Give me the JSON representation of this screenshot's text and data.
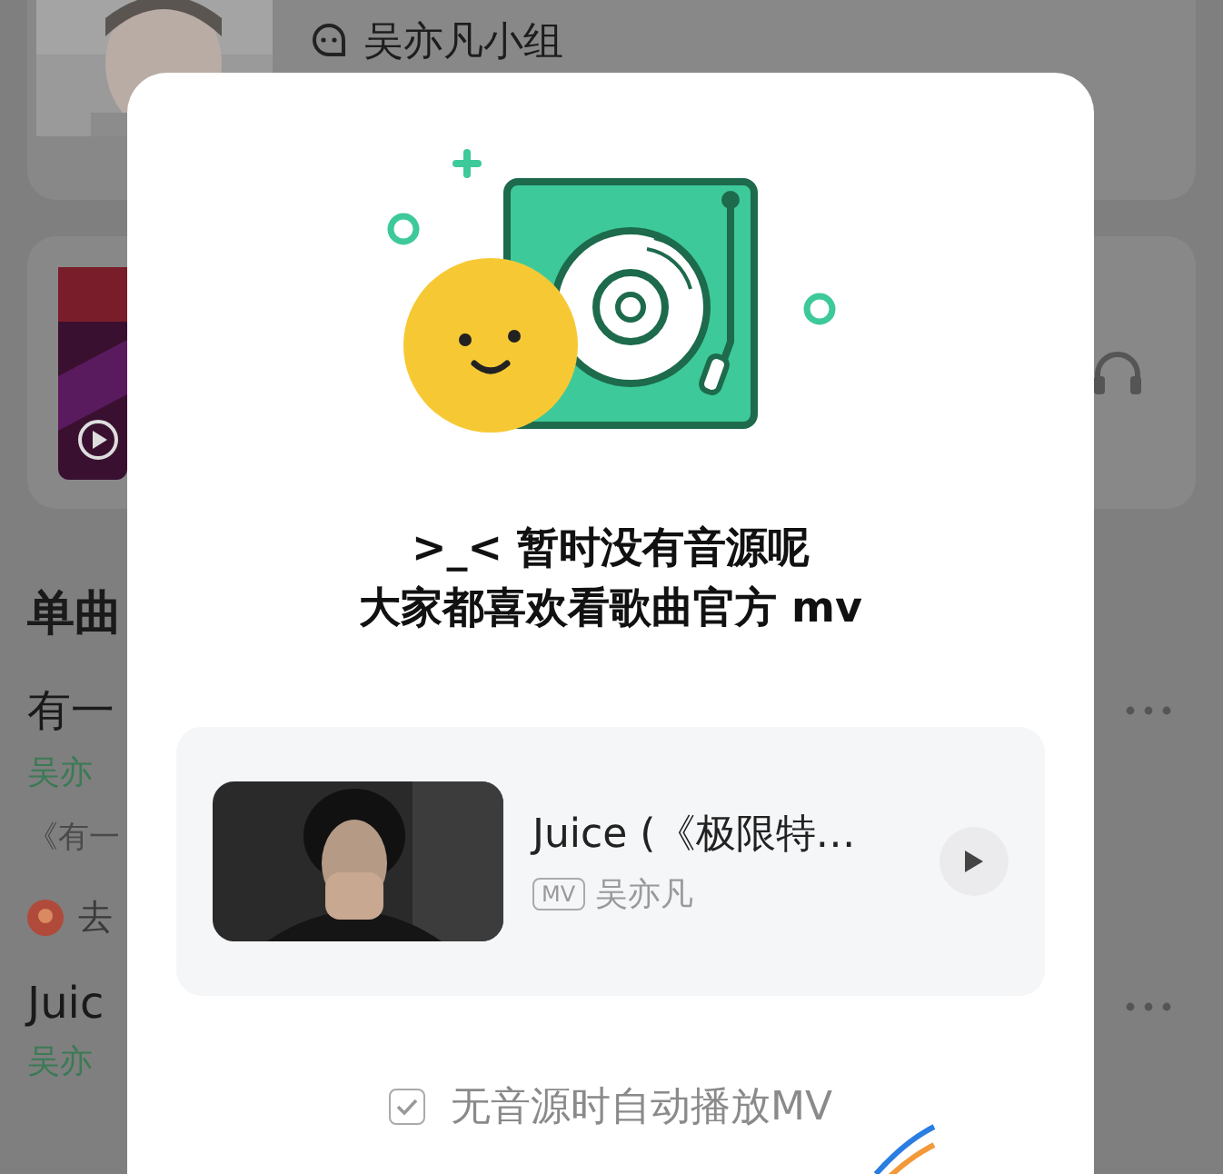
{
  "background": {
    "group": {
      "name": "吴亦凡小组"
    },
    "section_title": "单曲",
    "songs": [
      {
        "title": "有一",
        "artist": "吴亦",
        "album": "《有一",
        "action": "去"
      },
      {
        "title": "Juic",
        "artist": "吴亦"
      }
    ]
  },
  "dialog": {
    "message": [
      ">_< 暂时没有音源呢",
      "大家都喜欢看歌曲官方 mv"
    ],
    "mv": {
      "title": "Juice (《极限特…",
      "tag": "MV",
      "artist": "吴亦凡"
    },
    "autoplay": {
      "label": "无音源时自动播放MV",
      "checked": true
    }
  }
}
